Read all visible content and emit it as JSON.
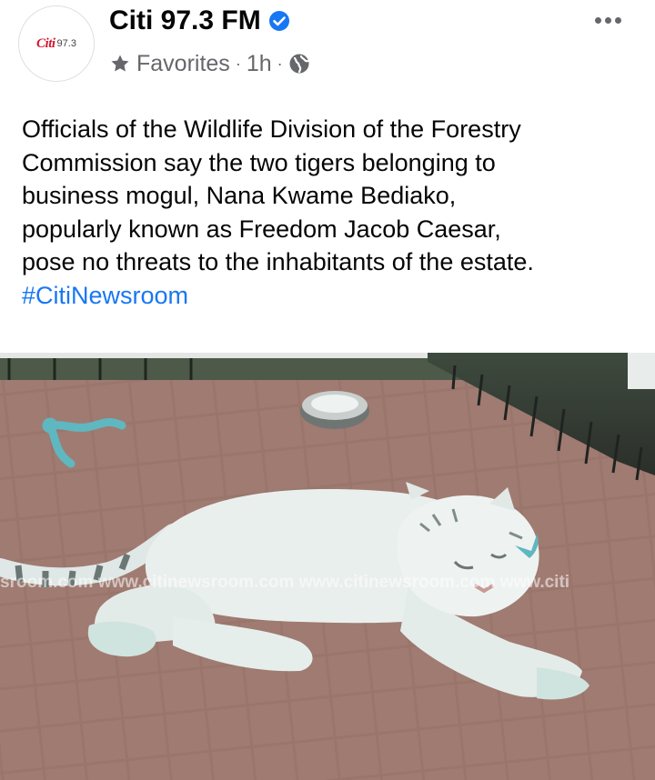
{
  "page": {
    "avatar_text": "Citi",
    "avatar_number": "97.3",
    "name": "Citi 97.3 FM"
  },
  "meta": {
    "audience": "Favorites",
    "separator": "·",
    "time": "1h"
  },
  "post": {
    "lines": [
      "Officials of the Wildlife Division of the Forestry",
      "Commission say the two tigers belonging to",
      "business mogul, Nana Kwame Bediako,",
      "popularly known as Freedom Jacob Caesar,",
      "pose no threats to the inhabitants of the estate."
    ],
    "hashtag": "#CitiNewsroom"
  },
  "photo": {
    "watermark": "sroom.com www.citinewsroom.com www.citinewsroom.com www.citi"
  },
  "colors": {
    "link": "#1877f2",
    "secondary_text": "#65676b",
    "brand_red": "#d3182f",
    "verified_blue": "#1877f2"
  },
  "icons": {
    "verified": "verified-badge-icon",
    "audience": "star-icon",
    "privacy": "globe-icon",
    "menu": "more-dots-icon"
  }
}
